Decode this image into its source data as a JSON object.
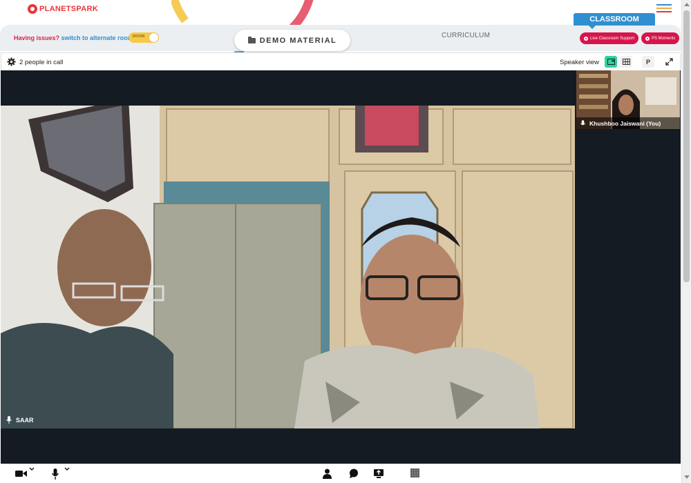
{
  "brand": {
    "name": "PLANETSPARK",
    "red": "#e8363a"
  },
  "header": {
    "classroom_tab": "CLASSROOM"
  },
  "issue_bar": {
    "question": "Having issues?",
    "link": "switch to alternate room",
    "toggle_label": "ROOM"
  },
  "toolbar": {
    "demo_material": "DEMO MATERIAL",
    "curriculum": "CURRICULUM",
    "live_support": "Live Classroom Support",
    "moments": "PS Moments"
  },
  "call": {
    "people_count": "2 people in call",
    "view_mode": "Speaker view",
    "presenter_btn": "P",
    "main_participant": "SAAR",
    "self_participant": "Khushboo Jaiswani (You)",
    "more": "..."
  },
  "icons": {
    "settings": "gear-icon",
    "speaker_layout": "speaker-layout-icon",
    "grid_layout": "grid-layout-icon",
    "fullscreen": "fullscreen-icon",
    "camera": "camera-icon",
    "mic": "mic-icon",
    "participants": "person-icon",
    "chat": "chat-icon",
    "share": "share-screen-icon",
    "whiteboard": "whiteboard-icon"
  },
  "colors": {
    "accent": "#2f8fd0",
    "pink": "#d7144b",
    "stage": "#141b22",
    "active_view": "#32d39a"
  }
}
